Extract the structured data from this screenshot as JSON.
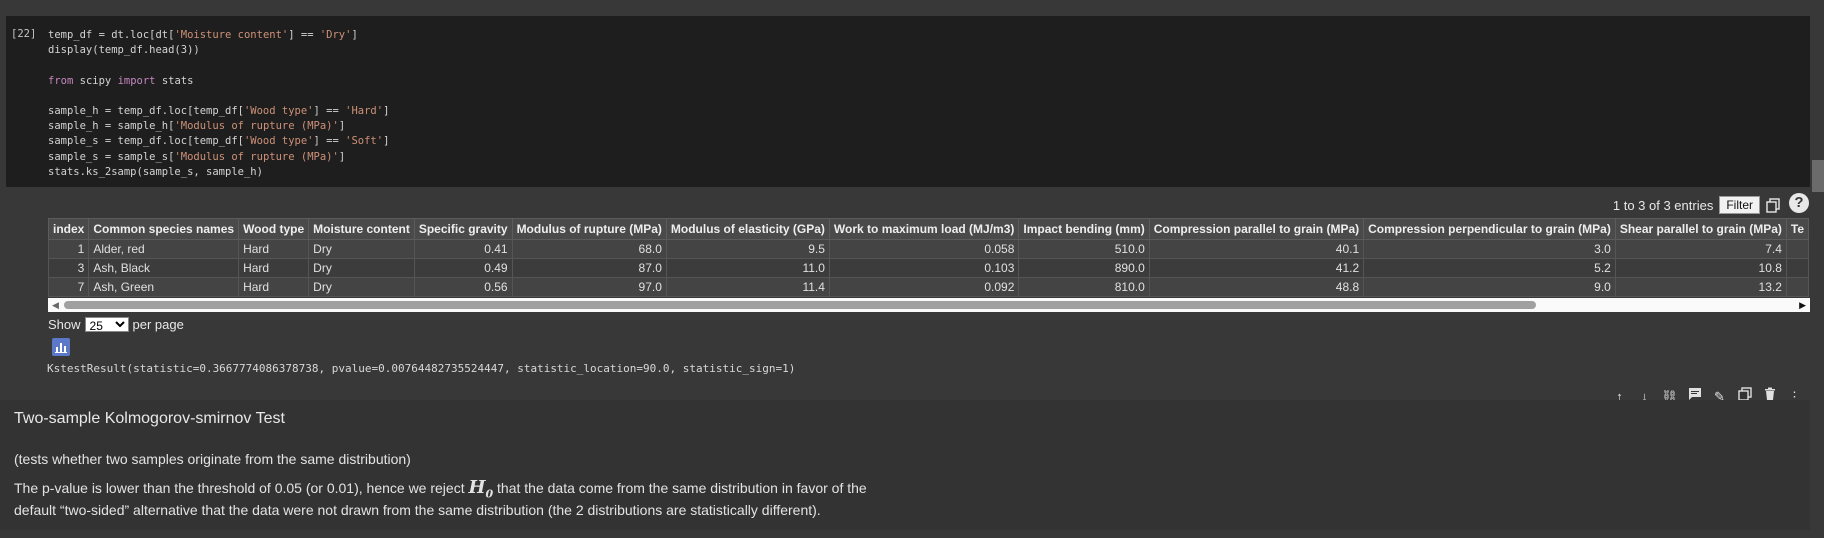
{
  "code_cell": {
    "exec_count": "[22]",
    "lines": [
      [
        {
          "t": "temp_df = dt.loc[dt[",
          "c": ""
        },
        {
          "t": "'Moisture content'",
          "c": "str"
        },
        {
          "t": "] == ",
          "c": ""
        },
        {
          "t": "'Dry'",
          "c": "str"
        },
        {
          "t": "]",
          "c": ""
        }
      ],
      [
        {
          "t": "display(temp_df.head(3))",
          "c": ""
        }
      ],
      [],
      [
        {
          "t": "from",
          "c": "kw"
        },
        {
          "t": " scipy ",
          "c": ""
        },
        {
          "t": "import",
          "c": "kw"
        },
        {
          "t": " stats",
          "c": ""
        }
      ],
      [],
      [
        {
          "t": "sample_h = temp_df.loc[temp_df[",
          "c": ""
        },
        {
          "t": "'Wood type'",
          "c": "str"
        },
        {
          "t": "] == ",
          "c": ""
        },
        {
          "t": "'Hard'",
          "c": "str"
        },
        {
          "t": "]",
          "c": ""
        }
      ],
      [
        {
          "t": "sample_h = sample_h[",
          "c": ""
        },
        {
          "t": "'Modulus of rupture (MPa)'",
          "c": "str"
        },
        {
          "t": "]",
          "c": ""
        }
      ],
      [
        {
          "t": "sample_s = temp_df.loc[temp_df[",
          "c": ""
        },
        {
          "t": "'Wood type'",
          "c": "str"
        },
        {
          "t": "] == ",
          "c": ""
        },
        {
          "t": "'Soft'",
          "c": "str"
        },
        {
          "t": "]",
          "c": ""
        }
      ],
      [
        {
          "t": "sample_s = sample_s[",
          "c": ""
        },
        {
          "t": "'Modulus of rupture (MPa)'",
          "c": "str"
        },
        {
          "t": "]",
          "c": ""
        }
      ],
      [
        {
          "t": "stats.ks_2samp(sample_s, sample_h)",
          "c": ""
        }
      ]
    ]
  },
  "table": {
    "info": "1 to 3 of 3 entries",
    "filter_label": "Filter",
    "help_label": "?",
    "columns": [
      "index",
      "Common species names",
      "Wood type",
      "Moisture content",
      "Specific gravity",
      "Modulus of rupture (MPa)",
      "Modulus of elasticity (GPa)",
      "Work to maximum load (MJ/m3)",
      "Impact bending (mm)",
      "Compression parallel to grain (MPa)",
      "Compression perpendicular to grain (MPa)",
      "Shear parallel to grain (MPa)",
      "Te"
    ],
    "numeric_cols": [
      0,
      4,
      5,
      6,
      7,
      8,
      9,
      10,
      11
    ],
    "rows": [
      [
        "1",
        "Alder, red",
        "Hard",
        "Dry",
        "0.41",
        "68.0",
        "9.5",
        "0.058",
        "510.0",
        "40.1",
        "3.0",
        "7.4",
        ""
      ],
      [
        "3",
        "Ash, Black",
        "Hard",
        "Dry",
        "0.49",
        "87.0",
        "11.0",
        "0.103",
        "890.0",
        "41.2",
        "5.2",
        "10.8",
        ""
      ],
      [
        "7",
        "Ash, Green",
        "Hard",
        "Dry",
        "0.56",
        "97.0",
        "11.4",
        "0.092",
        "810.0",
        "48.8",
        "9.0",
        "13.2",
        ""
      ]
    ],
    "show_label": "Show",
    "per_page_value": "25",
    "per_page_label": "per page"
  },
  "output_text": "KstestResult(statistic=0.3667774086378738, pvalue=0.00764482735524447, statistic_location=90.0, statistic_sign=1)",
  "toolbar_icons": [
    "arrow-up-icon",
    "arrow-down-icon",
    "link-icon",
    "comment-icon",
    "edit-icon",
    "mirror-cell-icon",
    "delete-icon",
    "more-icon"
  ],
  "markdown": {
    "title": "Two-sample Kolmogorov-smirnov Test",
    "p1": "(tests whether two samples originate from the same distribution)",
    "p2_before": "The p-value is lower than the threshold of 0.05 (or 0.01), hence we reject ",
    "h0": "H",
    "h0_sub": "0",
    "p2_after": " that the data come from the same distribution in favor of the",
    "p3": "default “two-sided” alternative that the data were not drawn from the same distribution (the 2 distributions are statistically different)."
  }
}
